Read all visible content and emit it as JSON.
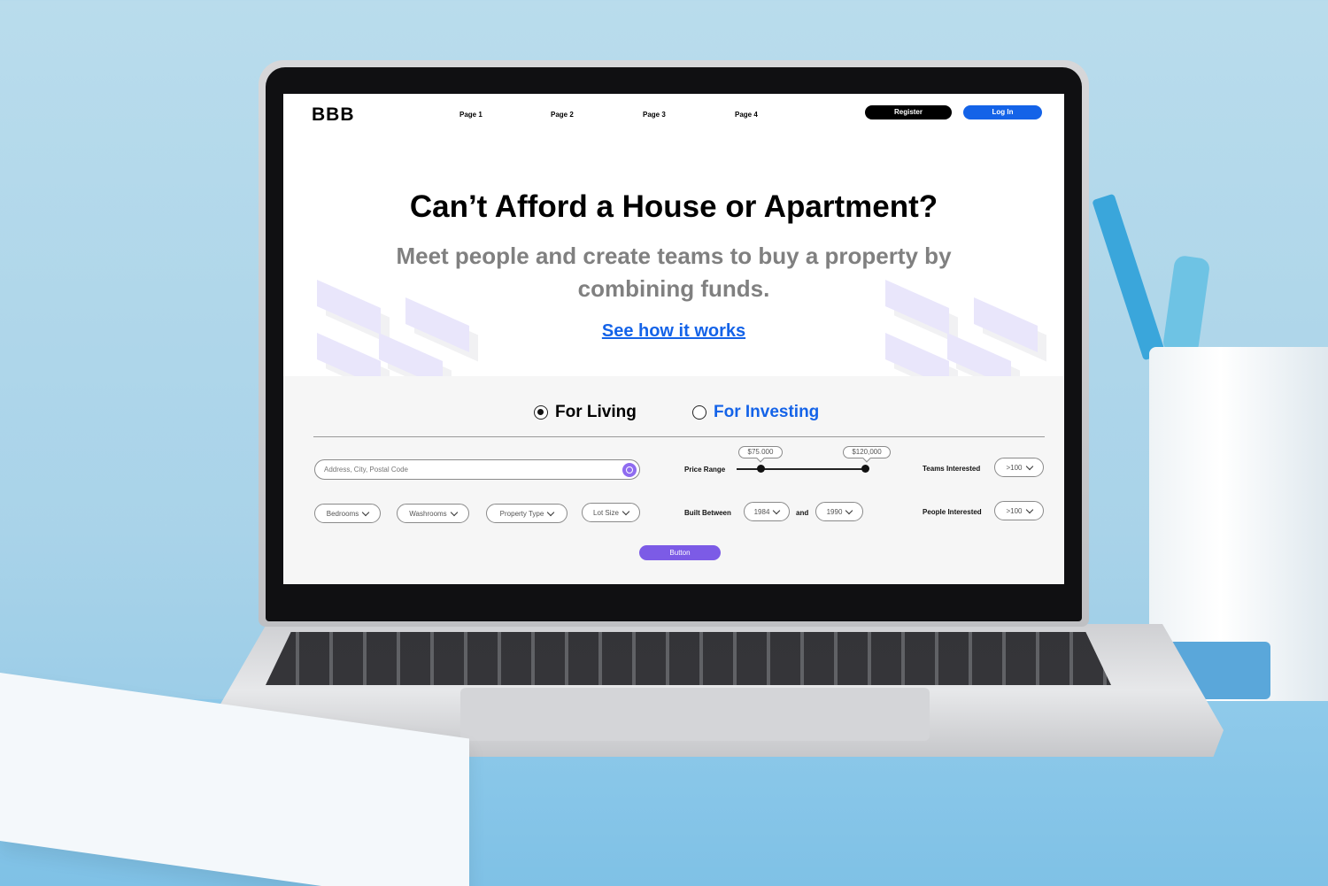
{
  "header": {
    "logo": "BBB",
    "nav": [
      "Page 1",
      "Page 2",
      "Page 3",
      "Page 4"
    ],
    "register_label": "Register",
    "login_label": "Log In"
  },
  "hero": {
    "title": "Can’t Afford a House or Apartment?",
    "subtitle": "Meet people and create teams to buy a property by combining funds.",
    "cta_link": "See how it works"
  },
  "mode": {
    "options": [
      "For Living",
      "For Investing"
    ],
    "selected": "For Living"
  },
  "filters": {
    "search_placeholder": "Address, City, Postal Code",
    "bedrooms": "Bedrooms",
    "washrooms": "Washrooms",
    "property_type": "Property Type",
    "lot_size": "Lot Size",
    "price_range_label": "Price Range",
    "price_min": "$75,000",
    "price_max": "$120,000",
    "built_between_label": "Built Between",
    "built_from": "1984",
    "built_and": "and",
    "built_to": "1990",
    "teams_label": "Teams Interested",
    "teams_value": ">100",
    "people_label": "People Interested",
    "people_value": ">100",
    "submit_label": "Button"
  },
  "colors": {
    "brand_blue": "#1463e8",
    "accent_purple": "#7c5be6",
    "black": "#000000"
  }
}
